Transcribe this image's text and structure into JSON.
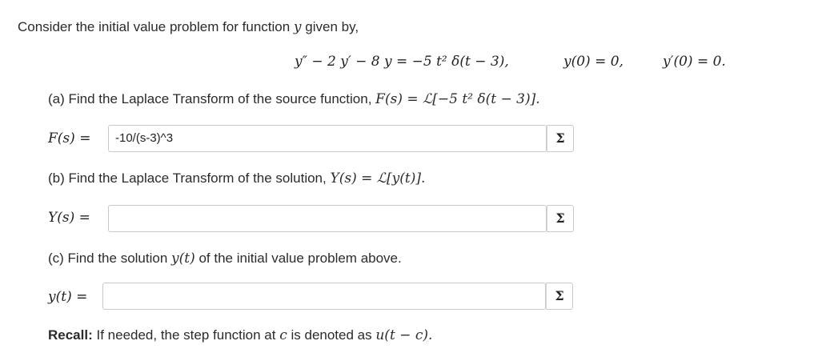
{
  "intro": "Consider the initial value problem for function",
  "intro_var": "y",
  "intro_end": "given by,",
  "ode": "y″ − 2 y′ − 8 y = −5 t² δ(t − 3),",
  "ic1": "y(0) = 0,",
  "ic2": "y′(0) = 0.",
  "part_a": {
    "text": "(a) Find the Laplace Transform of the source function,",
    "math": "F(s) = ℒ[−5 t² δ(t − 3)].",
    "label": "F(s) =",
    "value": "-10/(s-3)^3"
  },
  "part_b": {
    "text": "(b) Find the Laplace Transform of the solution,",
    "math": "Y(s) = ℒ[y(t)].",
    "label": "Y(s) =",
    "value": ""
  },
  "part_c": {
    "text": "(c) Find the solution",
    "math_var": "y(t)",
    "text_end": "of the initial value problem above.",
    "label": "y(t) =",
    "value": ""
  },
  "sigma_label": "Σ",
  "recall": {
    "bold": "Recall:",
    "text": "If needed, the step function at",
    "var": "c",
    "text2": "is denoted as",
    "math": "u(t − c)."
  }
}
